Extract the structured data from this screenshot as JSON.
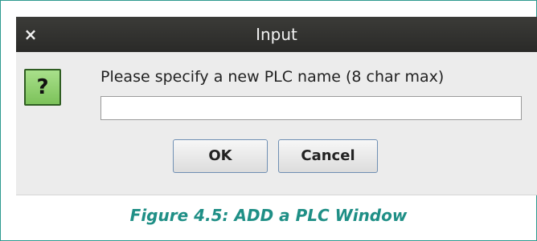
{
  "dialog": {
    "title": "Input",
    "close_glyph": "×",
    "icon": "question-icon",
    "icon_glyph": "?",
    "prompt": "Please specify a new PLC name (8 char max)",
    "input_value": "",
    "ok_label": "OK",
    "cancel_label": "Cancel"
  },
  "caption": "Figure 4.5: ADD a PLC Window",
  "colors": {
    "titlebar": "#2f2f2d",
    "dialog_bg": "#ececec",
    "icon_green": "#8fd06b",
    "caption": "#1f8f86",
    "frame_border": "#2e9a8f"
  }
}
